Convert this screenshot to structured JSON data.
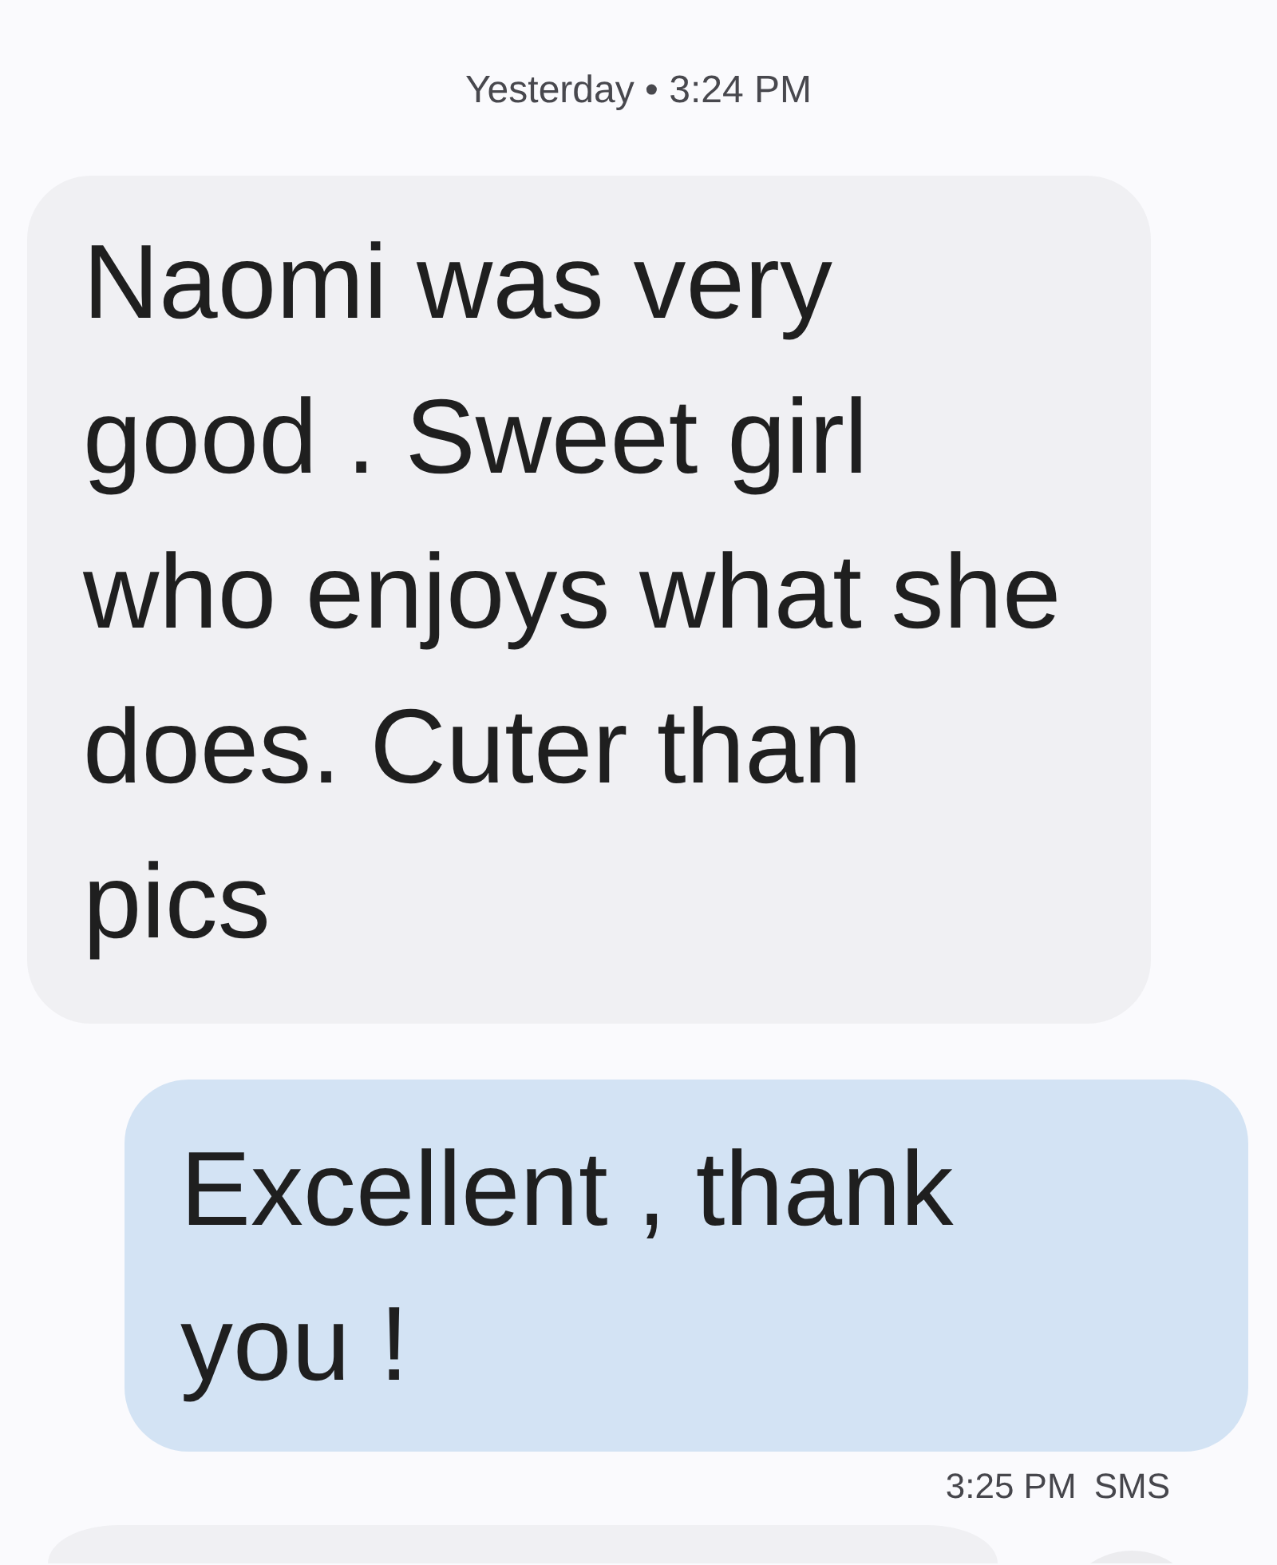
{
  "date_header": "Yesterday • 3:24 PM",
  "messages": [
    {
      "kind": "incoming",
      "text": "Naomi was very good . Sweet girl who enjoys what she does. Cuter than pics"
    },
    {
      "kind": "outgoing",
      "text": "Excellent , thank you !",
      "time": "3:25 PM",
      "channel": "SMS"
    }
  ]
}
